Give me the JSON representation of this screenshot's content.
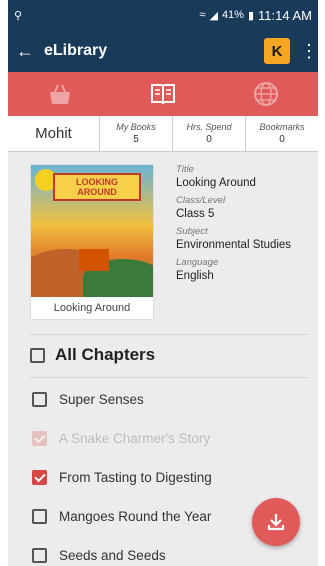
{
  "status_bar": {
    "time": "11:14 AM",
    "battery": "41%"
  },
  "app_bar": {
    "title": "eLibrary",
    "logo_letter": "K"
  },
  "tabs": [
    {
      "name": "bookshelf",
      "icon": "basket-icon"
    },
    {
      "name": "reader",
      "icon": "book-open-icon",
      "active": true
    },
    {
      "name": "online",
      "icon": "globe-icon"
    }
  ],
  "stats": {
    "user": "Mohit",
    "items": [
      {
        "label": "My Books",
        "value": "5"
      },
      {
        "label": "Hrs. Spend",
        "value": "0"
      },
      {
        "label": "Bookmarks",
        "value": "0"
      }
    ]
  },
  "book": {
    "cover_title": "LOOKING AROUND",
    "caption": "Looking Around",
    "fields": [
      {
        "label": "Title",
        "value": "Looking Around"
      },
      {
        "label": "Class/Level",
        "value": "Class 5"
      },
      {
        "label": "Subject",
        "value": "Environmental Studies"
      },
      {
        "label": "Language",
        "value": "English"
      }
    ]
  },
  "chapters": {
    "all_label": "All Chapters",
    "items": [
      {
        "label": "Super Senses",
        "checked": false,
        "faded": false
      },
      {
        "label": "A Snake Charmer's Story",
        "checked": true,
        "faded": true
      },
      {
        "label": "From Tasting to Digesting",
        "checked": true,
        "faded": false
      },
      {
        "label": "Mangoes Round the Year",
        "checked": false,
        "faded": false
      },
      {
        "label": "Seeds and Seeds",
        "checked": false,
        "faded": false
      }
    ]
  },
  "colors": {
    "primary": "#1a3a5a",
    "accent": "#e05a5a"
  }
}
